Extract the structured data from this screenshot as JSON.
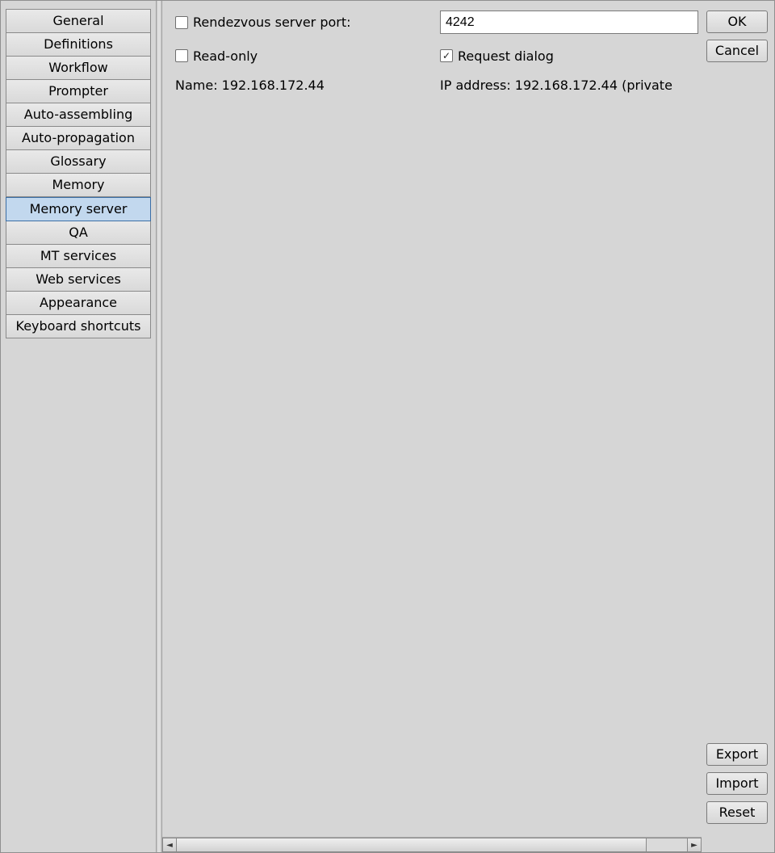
{
  "sidebar": {
    "items": [
      {
        "label": "General"
      },
      {
        "label": "Definitions"
      },
      {
        "label": "Workflow"
      },
      {
        "label": "Prompter"
      },
      {
        "label": "Auto-assembling"
      },
      {
        "label": "Auto-propagation"
      },
      {
        "label": "Glossary"
      },
      {
        "label": "Memory"
      },
      {
        "label": "Memory server"
      },
      {
        "label": "QA"
      },
      {
        "label": "MT services"
      },
      {
        "label": "Web services"
      },
      {
        "label": "Appearance"
      },
      {
        "label": "Keyboard shortcuts"
      }
    ],
    "selected_index": 8
  },
  "form": {
    "rendezvous_port_label": "Rendezvous server port:",
    "rendezvous_port_checked": false,
    "rendezvous_port_value": "4242",
    "read_only_label": "Read-only",
    "read_only_checked": false,
    "request_dialog_label": "Request dialog",
    "request_dialog_checked": true,
    "name_text": "Name: 192.168.172.44",
    "ip_text": "IP address: 192.168.172.44 (private"
  },
  "buttons": {
    "ok": "OK",
    "cancel": "Cancel",
    "export": "Export",
    "import": "Import",
    "reset": "Reset"
  }
}
